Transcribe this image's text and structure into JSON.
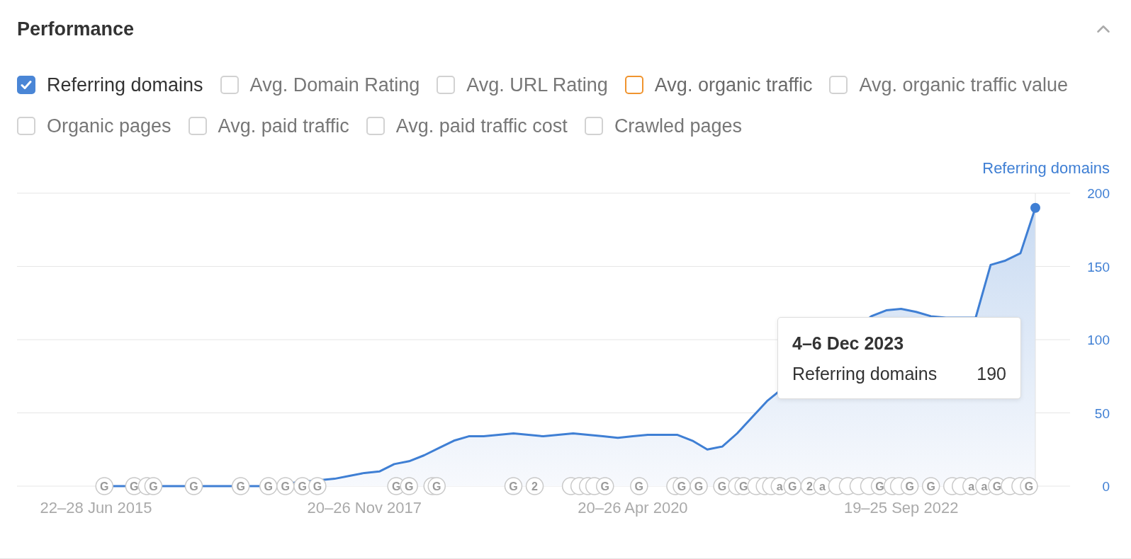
{
  "panel": {
    "title": "Performance",
    "expanded": true
  },
  "metrics": [
    {
      "label": "Referring domains",
      "checked": true,
      "hovered": false
    },
    {
      "label": "Avg. Domain Rating",
      "checked": false,
      "hovered": false
    },
    {
      "label": "Avg. URL Rating",
      "checked": false,
      "hovered": false
    },
    {
      "label": "Avg. organic traffic",
      "checked": false,
      "hovered": true
    },
    {
      "label": "Avg. organic traffic value",
      "checked": false,
      "hovered": false
    },
    {
      "label": "Organic pages",
      "checked": false,
      "hovered": false
    },
    {
      "label": "Avg. paid traffic",
      "checked": false,
      "hovered": false
    },
    {
      "label": "Avg. paid traffic cost",
      "checked": false,
      "hovered": false
    },
    {
      "label": "Crawled pages",
      "checked": false,
      "hovered": false
    }
  ],
  "chart": {
    "chart_data": {
      "type": "area",
      "categories": [
        "22–28 Jun 2015",
        null,
        null,
        null,
        null,
        null,
        null,
        null,
        null,
        null,
        null,
        null,
        null,
        null,
        null,
        null,
        null,
        null,
        "20–26 Nov 2017",
        null,
        null,
        null,
        null,
        null,
        null,
        null,
        null,
        null,
        null,
        null,
        null,
        null,
        null,
        null,
        null,
        null,
        "20–26 Apr 2020",
        null,
        null,
        null,
        null,
        null,
        null,
        null,
        null,
        null,
        null,
        null,
        null,
        null,
        null,
        null,
        null,
        null,
        "19–25 Sep 2022",
        null,
        null,
        null,
        null,
        null,
        null,
        null,
        null,
        null
      ],
      "series": [
        {
          "name": "Referring domains",
          "color": "#3f7fd4",
          "values": [
            0,
            null,
            0,
            null,
            null,
            0,
            0,
            null,
            0,
            0,
            null,
            0,
            null,
            null,
            null,
            null,
            5,
            7,
            9,
            10,
            15,
            17,
            21,
            26,
            31,
            34,
            34,
            35,
            36,
            35,
            34,
            35,
            36,
            35,
            34,
            33,
            34,
            35,
            35,
            35,
            31,
            25,
            27,
            36,
            47,
            58,
            null,
            null,
            null,
            null,
            null,
            null,
            116,
            120,
            121,
            119,
            116,
            115,
            115,
            115,
            151,
            154,
            159,
            190
          ]
        }
      ],
      "grid": true,
      "ylim": [
        0,
        200
      ],
      "yticks": [
        0,
        50,
        100,
        150,
        200
      ]
    },
    "events": [
      {
        "kind": "labelled",
        "text": "G"
      },
      {
        "kind": "labelled",
        "text": "G"
      },
      {
        "kind": "blank"
      },
      {
        "kind": "labelled",
        "text": "G"
      },
      {
        "kind": "labelled",
        "text": "G"
      },
      {
        "kind": "labelled",
        "text": "G"
      },
      {
        "kind": "labelled",
        "text": "G"
      },
      {
        "kind": "labelled",
        "text": "G"
      },
      {
        "kind": "labelled",
        "text": "G"
      },
      {
        "kind": "labelled",
        "text": "G"
      },
      {
        "kind": "labelled",
        "text": "G"
      },
      {
        "kind": "labelled",
        "text": "G"
      },
      {
        "kind": "blank"
      },
      {
        "kind": "labelled",
        "text": "G"
      },
      {
        "kind": "labelled",
        "text": "G"
      },
      {
        "kind": "labelled",
        "text": "2"
      },
      {
        "kind": "blank"
      },
      {
        "kind": "blank"
      },
      {
        "kind": "blank"
      },
      {
        "kind": "blank"
      },
      {
        "kind": "labelled",
        "text": "G"
      },
      {
        "kind": "labelled",
        "text": "G"
      },
      {
        "kind": "blank"
      },
      {
        "kind": "labelled",
        "text": "G"
      },
      {
        "kind": "labelled",
        "text": "G"
      },
      {
        "kind": "labelled",
        "text": "G"
      },
      {
        "kind": "blank"
      },
      {
        "kind": "labelled",
        "text": "G"
      },
      {
        "kind": "blank"
      },
      {
        "kind": "blank"
      },
      {
        "kind": "blank"
      },
      {
        "kind": "labelled",
        "text": "a"
      },
      {
        "kind": "labelled",
        "text": "G"
      },
      {
        "kind": "labelled",
        "text": "2"
      },
      {
        "kind": "labelled",
        "text": "a"
      },
      {
        "kind": "blank"
      },
      {
        "kind": "blank"
      },
      {
        "kind": "blank"
      },
      {
        "kind": "blank"
      },
      {
        "kind": "labelled",
        "text": "G"
      },
      {
        "kind": "blank"
      },
      {
        "kind": "blank"
      },
      {
        "kind": "labelled",
        "text": "G"
      },
      {
        "kind": "labelled",
        "text": "G"
      },
      {
        "kind": "blank"
      },
      {
        "kind": "blank"
      },
      {
        "kind": "labelled",
        "text": "a"
      },
      {
        "kind": "labelled",
        "text": "a"
      },
      {
        "kind": "labelled",
        "text": "G"
      },
      {
        "kind": "blank"
      },
      {
        "kind": "blank"
      },
      {
        "kind": "labelled",
        "text": "G"
      }
    ],
    "tooltip": {
      "title": "4–6 Dec 2023",
      "label": "Referring domains",
      "value": "190"
    }
  }
}
